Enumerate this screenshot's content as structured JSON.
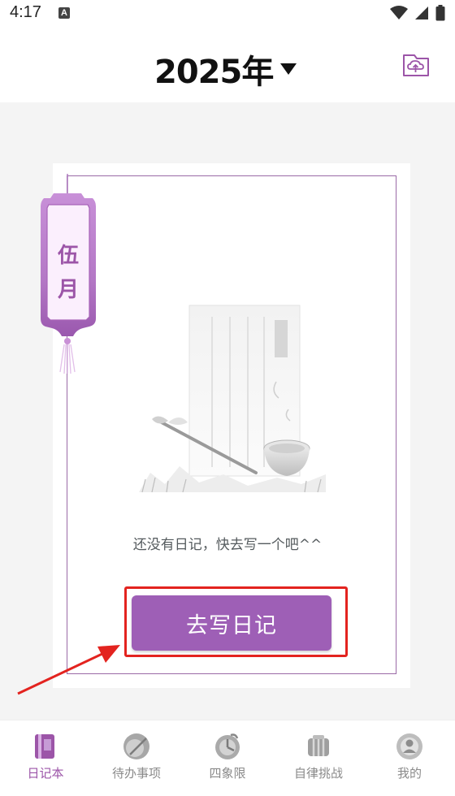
{
  "status_bar": {
    "time": "4:17",
    "badge": "A",
    "icons": [
      "wifi-icon",
      "signal-icon",
      "battery-icon"
    ]
  },
  "header": {
    "year_title": "2025年",
    "dropdown_icon": "caret-down-icon",
    "action_icon": "cloud-upload-icon"
  },
  "month_tag": {
    "line1": "伍",
    "line2": "月"
  },
  "empty_state": {
    "message": "还没有日记，快去写一个吧^^",
    "button_label": "去写日记"
  },
  "tabs": [
    {
      "label": "日记本",
      "icon": "diary-book-icon",
      "active": true
    },
    {
      "label": "待办事项",
      "icon": "todo-icon",
      "active": false
    },
    {
      "label": "四象限",
      "icon": "quadrant-icon",
      "active": false
    },
    {
      "label": "自律挑战",
      "icon": "challenge-icon",
      "active": false
    },
    {
      "label": "我的",
      "icon": "profile-icon",
      "active": false
    }
  ],
  "colors": {
    "accent": "#9e5fb6",
    "highlight": "#e3231f",
    "frame": "#9a6aa6"
  }
}
